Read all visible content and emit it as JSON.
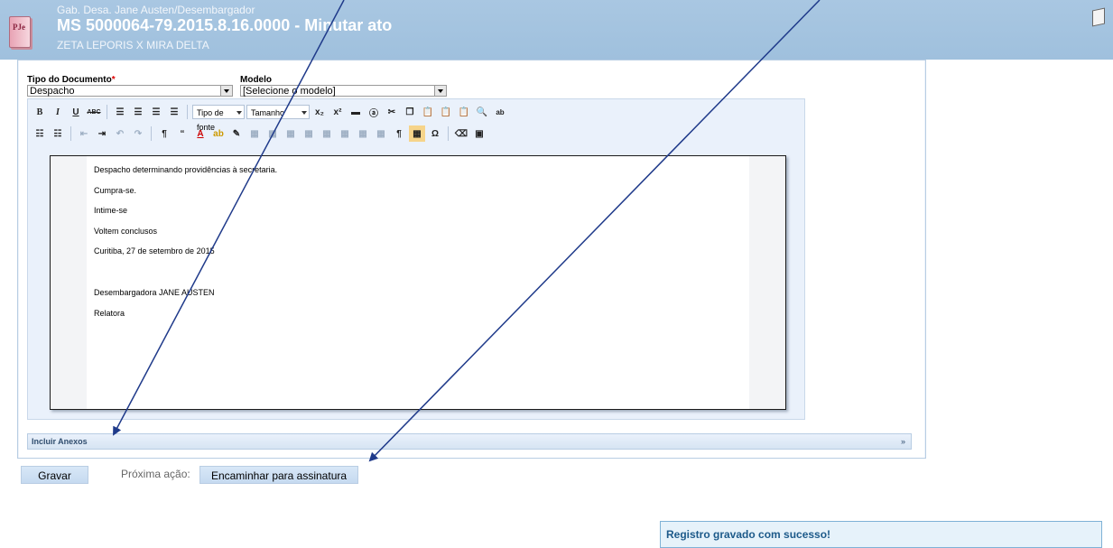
{
  "header": {
    "logo_text": "PJe",
    "line1": "Gab. Desa. Jane Austen/Desembargador",
    "title": "MS 5000064-79.2015.8.16.0000 - Minutar ato",
    "parties": "ZETA LEPORIS X MIRA DELTA"
  },
  "form": {
    "tipo_label": "Tipo do Documento",
    "required_mark": "*",
    "tipo_value": "Despacho",
    "modelo_label": "Modelo",
    "modelo_value": "[Selecione o modelo]"
  },
  "toolbar": {
    "font_drop": "Tipo de fonte",
    "size_drop": "Tamanho"
  },
  "document": {
    "lines": [
      "Despacho determinando providências à secretaria.",
      "Cumpra-se.",
      "Intime-se",
      "Voltem conclusos",
      "Curitiba, 27 de setembro de 2015",
      "Desembargadora JANE AUSTEN",
      "Relatora"
    ]
  },
  "anexos": {
    "label": "Incluir Anexos",
    "expand": "»"
  },
  "actions": {
    "save": "Gravar",
    "next_label": "Próxima ação:",
    "next_button": "Encaminhar para assinatura"
  },
  "notice": "Registro gravado com sucesso!",
  "colors": {
    "header": "#a9c7e2",
    "arrow": "#1f3a8a",
    "notice": "#1d5a8a"
  }
}
